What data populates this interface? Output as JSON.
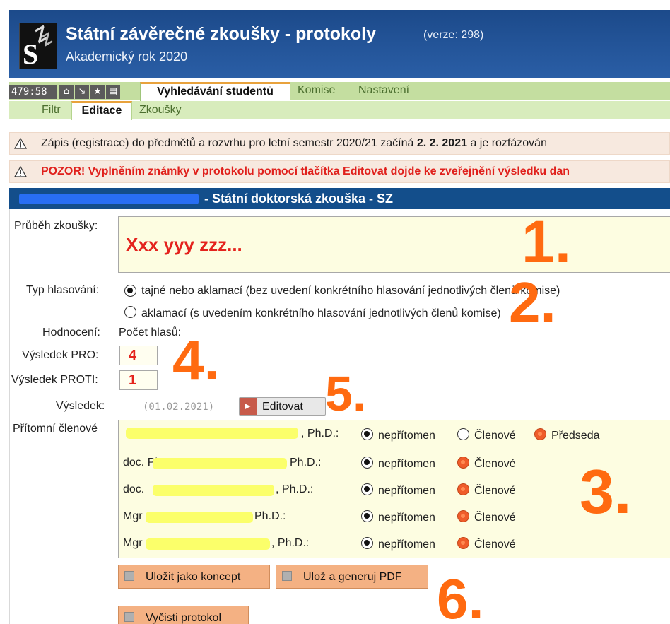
{
  "app": {
    "title": "Státní závěrečné zkoušky - protokoly",
    "version": "(verze: 298)",
    "academic_year": "Akademický rok 2020",
    "logo_text": "SZZ"
  },
  "nav": {
    "timer": "479:58",
    "tabs": [
      {
        "label": "Vyhledávání studentů",
        "active": true
      },
      {
        "label": "Komise",
        "active": false
      },
      {
        "label": "Nastavení",
        "active": false
      }
    ],
    "subtabs": [
      {
        "label": "Filtr",
        "active": false
      },
      {
        "label": "Editace",
        "active": true
      },
      {
        "label": "Zkoušky",
        "active": false
      }
    ]
  },
  "notices": [
    {
      "text": "Zápis (registrace) do předmětů a rozvrhu pro letní semestr 2020/21 začíná",
      "bold": "2. 2. 2021",
      "rest": "a je rozfázován"
    },
    {
      "text": "POZOR! Vyplněním známky v protokolu pomocí tlačítka Editovat dojde ke zveřejnění výsledku dan"
    }
  ],
  "section": {
    "title": "- Státní doktorská zkouška - SZ"
  },
  "form": {
    "prubeh_label": "Průběh zkoušky:",
    "prubeh_value": "Xxx yyy zzz...",
    "typ_label": "Typ hlasování:",
    "typ_options": [
      {
        "label": "tajné nebo aklamací (bez uvedení konkrétního hlasování jednotlivých členů komise)",
        "selected": true
      },
      {
        "label": "aklamací (s uvedením konkrétního hlasování jednotlivých členů komise)",
        "selected": false
      }
    ],
    "hodnoceni_label": "Hodnocení:",
    "pocet_label": "Počet hlasů:",
    "pro_label": "Výsledek PRO:",
    "pro_value": "4",
    "proti_label": "Výsledek PROTI:",
    "proti_value": "1",
    "vysledek_label": "Výsledek:",
    "vysledek_date": "(01.02.2021)",
    "edit_button": "Editovat",
    "members_label": "Přítomní členové",
    "members": [
      {
        "name_suffix": ", Ph.D.:",
        "prefix": "",
        "options": [
          "nepřítomen",
          "Členové",
          "Předseda"
        ],
        "selected": "Předseda"
      },
      {
        "name_suffix": "Ph.D.:",
        "prefix": "doc. PhDr.",
        "options": [
          "nepřítomen",
          "Členové"
        ],
        "selected": "Členové"
      },
      {
        "name_suffix": ", Ph.D.:",
        "prefix": "doc. ",
        "options": [
          "nepřítomen",
          "Členové"
        ],
        "selected": "Členové"
      },
      {
        "name_suffix": "Ph.D.:",
        "prefix": "Mgr",
        "options": [
          "nepřítomen",
          "Členové"
        ],
        "selected": "Členové"
      },
      {
        "name_suffix": ", Ph.D.:",
        "prefix": "Mgr",
        "options": [
          "nepřítomen",
          "Členové"
        ],
        "selected": "Členové"
      }
    ],
    "save_concept": "Uložit jako koncept",
    "save_pdf": "Ulož a generuj PDF",
    "clear": "Vyčisti protokol"
  },
  "annotations": [
    "1.",
    "2.",
    "3.",
    "4.",
    "5.",
    "6."
  ],
  "colors": {
    "header": "#1e4f91",
    "nav": "#c4dea0",
    "accent": "#e8a23c",
    "error": "#e0201c",
    "annotation": "#ff6a10"
  }
}
